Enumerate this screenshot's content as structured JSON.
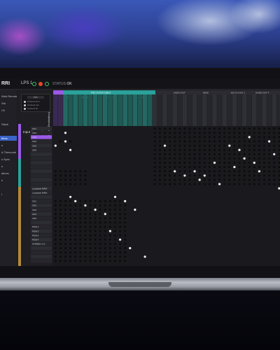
{
  "header": {
    "logo": "RRI",
    "device_name": "LPS 1",
    "status_label": "STATUS",
    "status_value": "OK"
  },
  "sidebar": {
    "items": [
      {
        "label": "Web Remote"
      },
      {
        "label": "Sta"
      },
      {
        "label": "Ch"
      },
      {
        "label": ""
      },
      {
        "label": "Stack"
      },
      {
        "label": ""
      },
      {
        "label": "ttens"
      },
      {
        "label": "s"
      },
      {
        "label": "& Timecode"
      },
      {
        "label": "s Sync"
      },
      {
        "label": "s"
      },
      {
        "label": "ations"
      },
      {
        "label": "n"
      },
      {
        "label": ""
      },
      {
        "label": "l"
      }
    ],
    "active_index": 6
  },
  "legend": {
    "top": "SRC",
    "rows": [
      "Connect sum",
      "Connect ove",
      "Connect ch"
    ]
  },
  "labels": {
    "output_vertical": "Output (Destination)",
    "input_title": "Input (Source)"
  },
  "colors": {
    "accent_purple": "#9b59e8",
    "accent_teal": "#2aa19a",
    "accent_gold": "#b48a3a",
    "dot_white": "#f2f2f2",
    "dot_dark": "#0c0c0c"
  },
  "groups": {
    "top": [
      {
        "label": "Pilot Control Output",
        "color": "teal"
      },
      {
        "label": "AUDIO OUT",
        "color": "dark"
      },
      {
        "label": "HDMI",
        "color": "dark"
      },
      {
        "label": "DIO CH OUT 1",
        "color": "dark"
      },
      {
        "label": "SI AES OUT 4",
        "color": "dark"
      }
    ],
    "sub": [
      "LR",
      "X-EQ",
      "BCT LD",
      "Combine",
      "Channel"
    ],
    "input_rows": [
      "CH1",
      "CH2",
      "CH3",
      "CH4",
      "CH5",
      "CH6",
      "",
      "",
      "",
      "",
      "",
      "",
      "",
      "",
      "Loopback MAIN",
      "Loopback MAIN",
      "",
      "CH1",
      "CH2",
      "CH3",
      "CH4",
      "CH5",
      "",
      "PGM 1",
      "PGM 2",
      "PGM 3",
      "PGM 4",
      "STEREO 1+2",
      "",
      "",
      "",
      ""
    ]
  }
}
